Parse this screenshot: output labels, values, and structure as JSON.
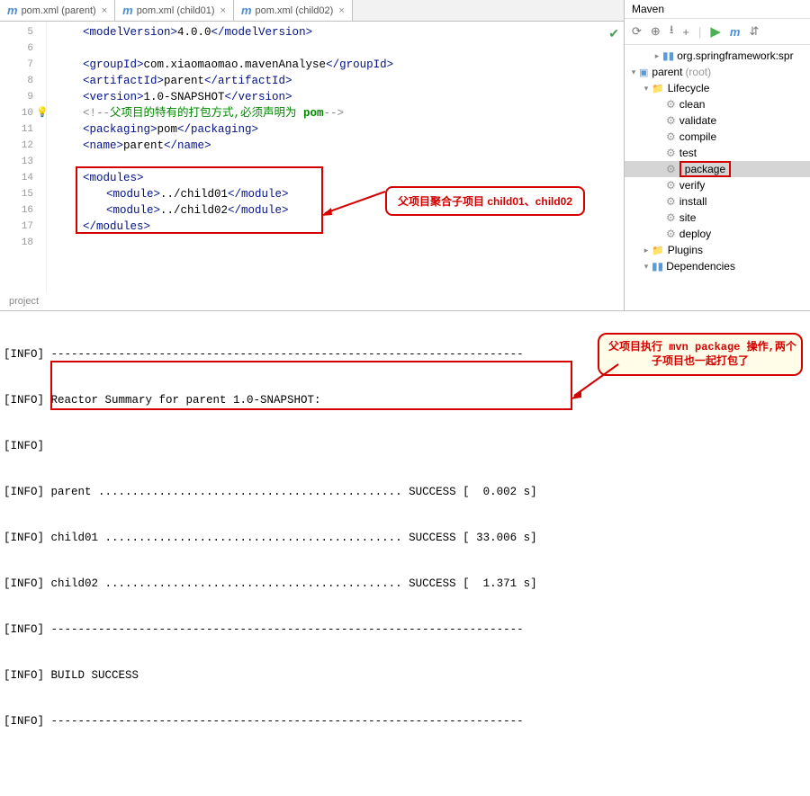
{
  "tabs": [
    {
      "label": "pom.xml (parent)"
    },
    {
      "label": "pom.xml (child01)"
    },
    {
      "label": "pom.xml (child02)"
    }
  ],
  "gutter": [
    "5",
    "6",
    "7",
    "8",
    "9",
    "10",
    "11",
    "12",
    "13",
    "14",
    "15",
    "16",
    "17",
    "18"
  ],
  "code": {
    "l5a": "<modelVersion>",
    "l5b": "4.0.0",
    "l5c": "</modelVersion>",
    "l7a": "<groupId>",
    "l7b": "com.xiaomaomao.mavenAnalyse",
    "l7c": "</groupId>",
    "l8a": "<artifactId>",
    "l8b": "parent",
    "l8c": "</artifactId>",
    "l9a": "<version>",
    "l9b": "1.0-SNAPSHOT",
    "l9c": "</version>",
    "l10a": "<!--",
    "l10b": "父项目的特有的打包方式,必须声明为 ",
    "l10c": "pom",
    "l10d": "-->",
    "l11a": "<packaging>",
    "l11b": "pom",
    "l11c": "</packaging>",
    "l12a": "<name>",
    "l12b": "parent",
    "l12c": "</name>",
    "l14": "<modules>",
    "l15a": "<module>",
    "l15b": "../child01",
    "l15c": "</module>",
    "l16a": "<module>",
    "l16b": "../child02",
    "l16c": "</module>",
    "l17": "</modules>"
  },
  "crumb": "project",
  "callout1": "父项目聚合子项目 child01、child02",
  "callout2_l1": "父项目执行 mvn package 操作,两个",
  "callout2_l2": "子项目也一起打包了",
  "maven": {
    "title": "Maven",
    "root": "parent",
    "root_note": "(root)",
    "lifecycle": "Lifecycle",
    "goals": [
      "clean",
      "validate",
      "compile",
      "test",
      "package",
      "verify",
      "install",
      "site",
      "deploy"
    ],
    "plugins": "Plugins",
    "deps": "Dependencies",
    "spring": "org.springframework:spr"
  },
  "console": {
    "p": "[INFO]",
    "dash": "----------------------------------------------------------------------",
    "summary": "Reactor Summary for parent 1.0-SNAPSHOT:",
    "r1": "parent ............................................. SUCCESS [  0.002 s]",
    "r2": "child01 ............................................ SUCCESS [ 33.006 s]",
    "r3": "child02 ............................................ SUCCESS [  1.371 s]",
    "build": "BUILD SUCCESS"
  }
}
